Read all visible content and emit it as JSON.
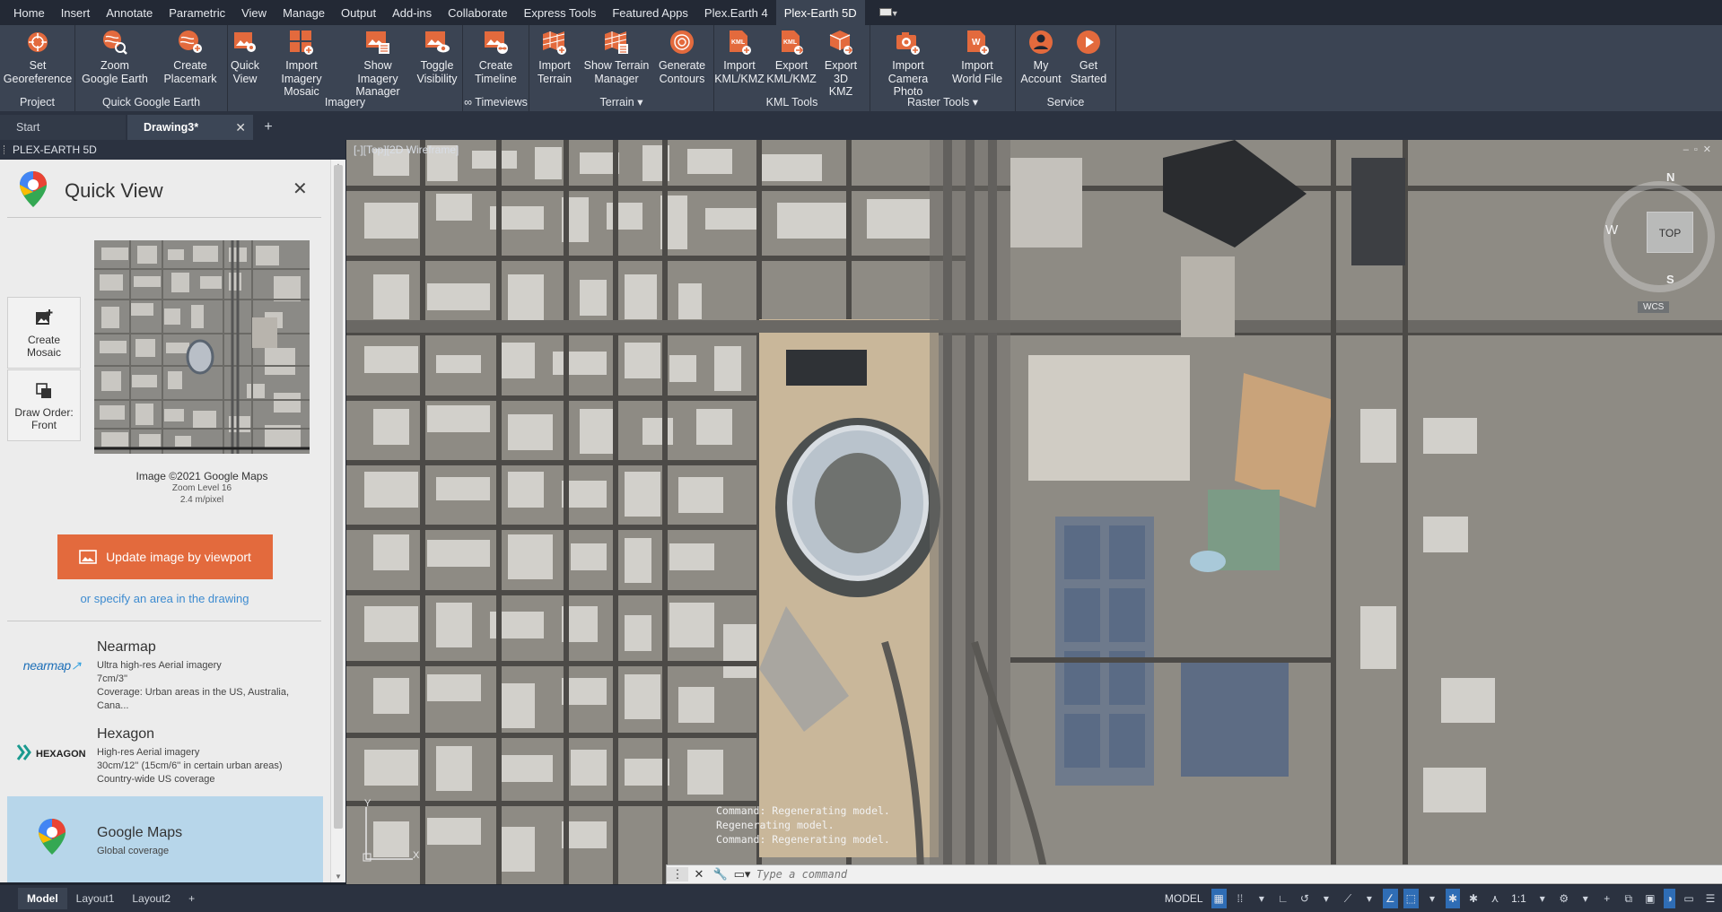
{
  "menu": {
    "tabs": [
      {
        "label": "Home"
      },
      {
        "label": "Insert"
      },
      {
        "label": "Annotate"
      },
      {
        "label": "Parametric"
      },
      {
        "label": "View"
      },
      {
        "label": "Manage"
      },
      {
        "label": "Output"
      },
      {
        "label": "Add-ins"
      },
      {
        "label": "Collaborate"
      },
      {
        "label": "Express Tools"
      },
      {
        "label": "Featured Apps"
      },
      {
        "label": "Plex.Earth 4"
      },
      {
        "label": "Plex-Earth 5D"
      }
    ],
    "active": "Plex-Earth 5D"
  },
  "ribbon": {
    "panels": [
      {
        "title": "Project",
        "buttons": [
          {
            "label": "Set\nGeoreference",
            "icon": "georeference-icon"
          }
        ]
      },
      {
        "title": "Quick Google Earth",
        "buttons": [
          {
            "label": "Zoom\nGoogle Earth",
            "icon": "zoom-google-earth-icon"
          },
          {
            "label": "Create\nPlacemark",
            "icon": "placemark-icon"
          }
        ]
      },
      {
        "title": "Imagery",
        "buttons": [
          {
            "label": "Quick\nView",
            "icon": "quick-view-icon"
          },
          {
            "label": "Import Imagery\nMosaic",
            "icon": "mosaic-icon"
          },
          {
            "label": "Show Imagery\nManager",
            "icon": "imagery-manager-icon"
          },
          {
            "label": "Toggle\nVisibility",
            "icon": "visibility-icon"
          }
        ]
      },
      {
        "title": "∞ Timeviews",
        "buttons": [
          {
            "label": "Create\nTimeline",
            "icon": "timeline-icon"
          }
        ]
      },
      {
        "title": "Terrain ▾",
        "buttons": [
          {
            "label": "Import\nTerrain",
            "icon": "terrain-icon"
          },
          {
            "label": "Show Terrain\nManager",
            "icon": "terrain-manager-icon"
          },
          {
            "label": "Generate\nContours",
            "icon": "contours-icon"
          }
        ]
      },
      {
        "title": "KML Tools",
        "buttons": [
          {
            "label": "Import\nKML/KMZ",
            "icon": "import-kml-icon"
          },
          {
            "label": "Export\nKML/KMZ",
            "icon": "export-kml-icon"
          },
          {
            "label": "Export\n3D KMZ",
            "icon": "export-3d-kmz-icon"
          }
        ]
      },
      {
        "title": "Raster Tools ▾",
        "buttons": [
          {
            "label": "Import\nCamera Photo",
            "icon": "camera-photo-icon"
          },
          {
            "label": "Import\nWorld File",
            "icon": "world-file-icon"
          }
        ]
      },
      {
        "title": "Service",
        "buttons": [
          {
            "label": "My\nAccount",
            "icon": "account-icon"
          },
          {
            "label": "Get\nStarted",
            "icon": "play-icon"
          }
        ]
      }
    ]
  },
  "doctabs": {
    "start": "Start",
    "drawing": "Drawing3*",
    "close": "✕",
    "add": "+"
  },
  "palette": {
    "header": "PLEX-EARTH 5D",
    "title": "Quick View",
    "close": "✕",
    "side_buttons": [
      {
        "label": "Create\nMosaic"
      },
      {
        "label": "Draw Order:\nFront"
      }
    ],
    "image_caption": "Image ©2021 Google Maps",
    "zoom_level": "Zoom Level 16",
    "resolution": "2.4 m/pixel",
    "update_button": "Update image by viewport",
    "specify_link": "or specify an area in the drawing",
    "providers": [
      {
        "name": "Nearmap",
        "desc": "Ultra high-res Aerial imagery\n7cm/3''\nCoverage: Urban areas in the US, Australia, Cana...",
        "logo": "nearmap",
        "selected": false
      },
      {
        "name": "Hexagon",
        "desc": "High-res Aerial imagery\n30cm/12'' (15cm/6'' in certain urban areas)\nCountry-wide US coverage",
        "logo": "HEXAGON",
        "selected": false
      },
      {
        "name": "Google Maps",
        "desc": "Global coverage",
        "logo": "google-maps",
        "selected": true
      }
    ]
  },
  "viewport": {
    "label": "[-][Top][2D Wireframe]",
    "viewcube": {
      "n": "N",
      "w": "W",
      "s": "S",
      "top": "TOP",
      "wcs": "WCS"
    },
    "ucs": {
      "y": "Y",
      "x": "X"
    },
    "command_history": [
      "Command: Regenerating model.",
      "Regenerating model.",
      "Command: Regenerating model."
    ],
    "command_placeholder": "Type a command"
  },
  "statusbar": {
    "layouts": [
      {
        "label": "Model",
        "active": true
      },
      {
        "label": "Layout1",
        "active": false
      },
      {
        "label": "Layout2",
        "active": false
      }
    ],
    "add": "+",
    "model": "MODEL",
    "scale": "1:1"
  },
  "colors": {
    "accent": "#e36a3d",
    "ribbon": "#3b4453",
    "selected": "#b7d6ea",
    "link": "#3d8bd0"
  }
}
